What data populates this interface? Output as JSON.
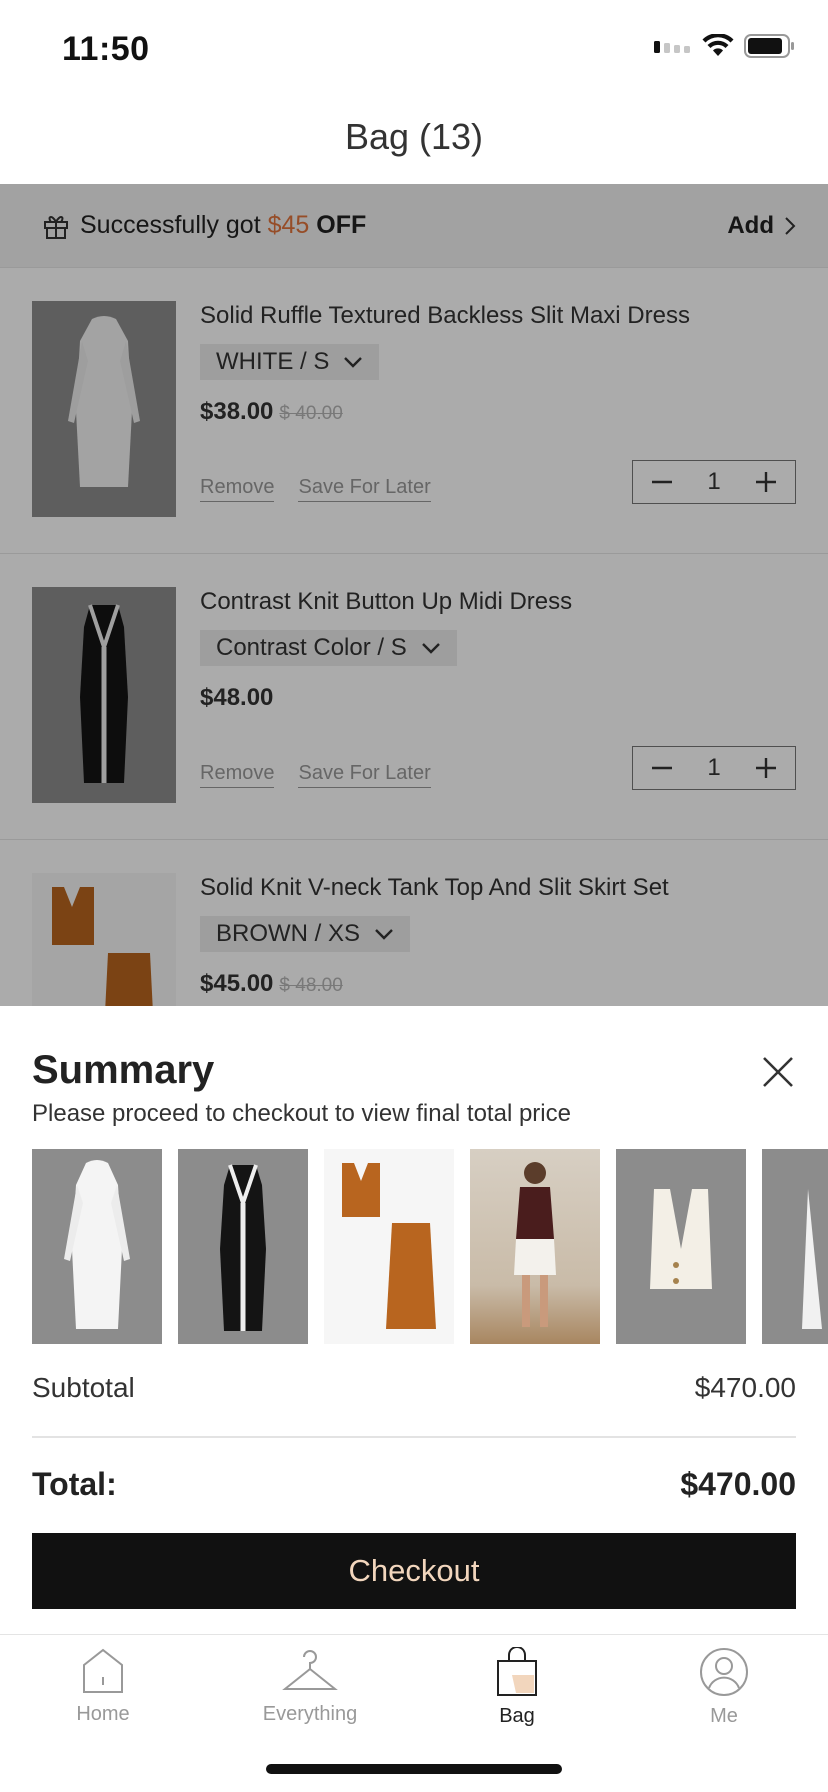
{
  "status_bar": {
    "time": "11:50"
  },
  "header": {
    "title": "Bag (13)"
  },
  "promo": {
    "prefix": "Successfully got ",
    "amount": "$45",
    "suffix": " OFF",
    "action": "Add"
  },
  "cart": {
    "items": [
      {
        "name": "Solid Ruffle Textured Backless Slit Maxi Dress",
        "variant": "WHITE / S",
        "price": "$38.00",
        "original_price": "$ 40.00",
        "remove": "Remove",
        "save_later": "Save For Later",
        "quantity": "1"
      },
      {
        "name": "Contrast Knit Button Up Midi Dress",
        "variant": "Contrast Color / S",
        "price": "$48.00",
        "remove": "Remove",
        "save_later": "Save For Later",
        "quantity": "1"
      },
      {
        "name": "Solid Knit V-neck Tank Top And Slit Skirt Set",
        "variant": "BROWN / XS",
        "price": "$45.00",
        "original_price": "$ 48.00"
      }
    ]
  },
  "summary": {
    "title": "Summary",
    "subtitle": "Please proceed to checkout to view final total price",
    "subtotal_label": "Subtotal",
    "subtotal_value": "$470.00",
    "total_label": "Total:",
    "total_value": "$470.00",
    "checkout_label": "Checkout"
  },
  "tabs": [
    {
      "label": "Home",
      "icon": "home-icon"
    },
    {
      "label": "Everything",
      "icon": "hanger-icon"
    },
    {
      "label": "Bag",
      "icon": "bag-icon",
      "active": true
    },
    {
      "label": "Me",
      "icon": "profile-icon"
    }
  ],
  "colors": {
    "accent": "#e0743d",
    "checkout_bg": "#111111",
    "checkout_text": "#f2d6bd"
  }
}
